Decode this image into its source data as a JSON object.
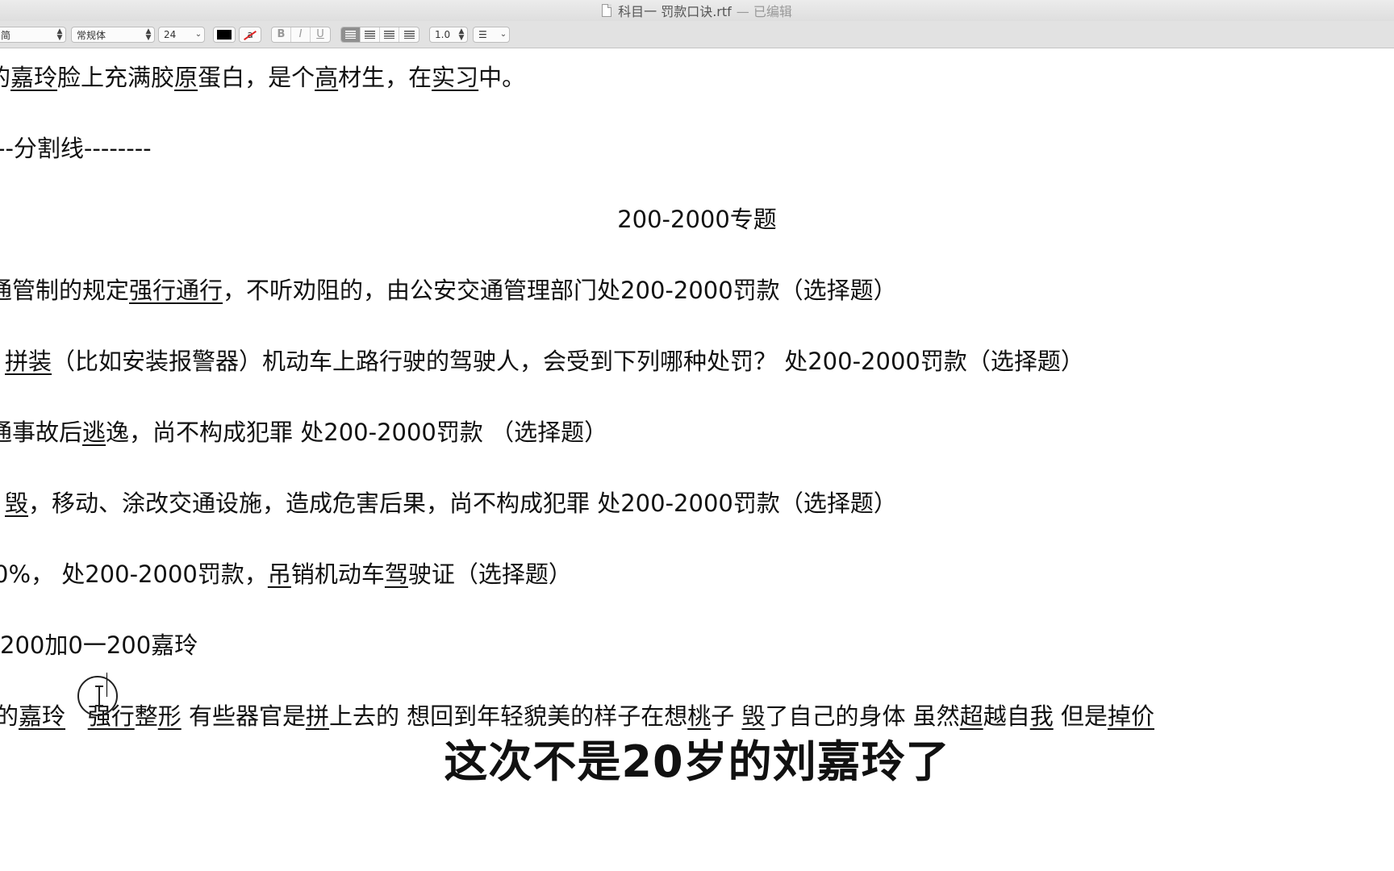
{
  "window": {
    "title": "科目一 罚款口诀.rtf",
    "edited_suffix": "— 已编辑"
  },
  "toolbar": {
    "paragraph_style": "简",
    "font_style": "常规体",
    "font_size": "24",
    "line_spacing": "1.0",
    "bold": "B",
    "italic": "I",
    "underline": "U",
    "highlight_glyph": "a",
    "text_color": "#000000"
  },
  "doc": {
    "line1": [
      "的",
      "嘉玲",
      "脸上充满胶",
      "原",
      "蛋白，是个",
      "高",
      "材生，在",
      "实习",
      "中。"
    ],
    "line2": "--分割线--------",
    "heading": "200-2000专题",
    "line3": [
      "通管制的规定",
      "强行",
      "通行",
      "，不听劝阻的，由公安交通管理部门处200-2000罚款（选择题）"
    ],
    "line4": [
      "拼装",
      "（比如安装报警器）机动车上路行驶的驾驶人，会受到下列哪种处罚？  处200-2000罚款（选择题）"
    ],
    "line5": [
      "通事故后",
      "逃",
      "逸，尚不构成犯罪  处200-2000罚款 （选择题）"
    ],
    "line6": [
      "毁",
      "，移动、涂改交通设施，造成危害后果，尚不构成犯罪  处200-2000罚款（选择题）"
    ],
    "line7": [
      "0%，  处200-2000罚款，",
      "吊",
      "销机动车",
      "驾",
      "驶证（选择题）"
    ],
    "line8": [
      "200加0",
      "一",
      "200嘉玲"
    ],
    "line9": [
      "的",
      "嘉玲",
      "   ",
      "强行",
      "整",
      "形",
      " 有些器官是",
      "拼",
      "上去的  想回到年轻貌美的样子在想",
      "桃",
      "子 ",
      "毁",
      "了自己的身体 虽然",
      "超",
      "越自",
      "我",
      " 但是",
      "掉价"
    ]
  },
  "subtitle": "这次不是20岁的刘嘉玲了"
}
